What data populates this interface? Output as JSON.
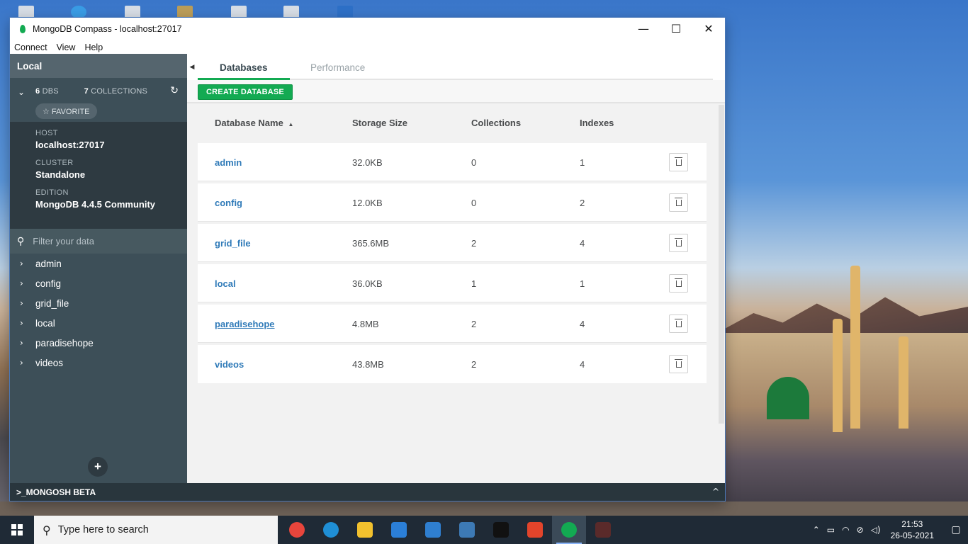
{
  "window": {
    "title": "MongoDB Compass - localhost:27017",
    "controls": {
      "minimize": "—",
      "maximize": "☐",
      "close": "✕"
    }
  },
  "menu": [
    "Connect",
    "View",
    "Help"
  ],
  "sidebar": {
    "header": "Local",
    "dbs_count": "6",
    "dbs_label": "DBS",
    "collections_count": "7",
    "collections_label": "COLLECTIONS",
    "favorite_label": "☆ FAVORITE",
    "host_label": "HOST",
    "host_value": "localhost:27017",
    "cluster_label": "CLUSTER",
    "cluster_value": "Standalone",
    "edition_label": "EDITION",
    "edition_value": "MongoDB 4.4.5 Community",
    "filter_placeholder": "Filter your data",
    "databases": [
      "admin",
      "config",
      "grid_file",
      "local",
      "paradisehope",
      "videos"
    ],
    "add_label": "+"
  },
  "tabs": {
    "active": "Databases",
    "inactive": "Performance"
  },
  "toolbar": {
    "create_label": "CREATE DATABASE"
  },
  "table": {
    "headers": {
      "name": "Database Name",
      "size": "Storage Size",
      "collections": "Collections",
      "indexes": "Indexes"
    },
    "sort_indicator": "▲",
    "rows": [
      {
        "name": "admin",
        "size": "32.0KB",
        "collections": "0",
        "indexes": "1"
      },
      {
        "name": "config",
        "size": "12.0KB",
        "collections": "0",
        "indexes": "2"
      },
      {
        "name": "grid_file",
        "size": "365.6MB",
        "collections": "2",
        "indexes": "4"
      },
      {
        "name": "local",
        "size": "36.0KB",
        "collections": "1",
        "indexes": "1"
      },
      {
        "name": "paradisehope",
        "size": "4.8MB",
        "collections": "2",
        "indexes": "4"
      },
      {
        "name": "videos",
        "size": "43.8MB",
        "collections": "2",
        "indexes": "4"
      }
    ]
  },
  "shell": {
    "label": ">_MONGOSH BETA",
    "toggle": "^"
  },
  "taskbar": {
    "search_placeholder": "Type here to search",
    "time": "21:53",
    "date": "26-05-2021",
    "apps": [
      {
        "name": "chrome",
        "color": "#e8453c"
      },
      {
        "name": "edge",
        "color": "#1f8fd6"
      },
      {
        "name": "file-explorer",
        "color": "#f2c12e"
      },
      {
        "name": "mail",
        "color": "#2b7fd8"
      },
      {
        "name": "store",
        "color": "#2f7fd0"
      },
      {
        "name": "python",
        "color": "#3d7ab5"
      },
      {
        "name": "terminal",
        "color": "#111111"
      },
      {
        "name": "p-app",
        "color": "#e2442b"
      },
      {
        "name": "mongodb-compass",
        "color": "#13aa52"
      },
      {
        "name": "game-app",
        "color": "#5a2a2a"
      }
    ]
  },
  "colors": {
    "accent": "#13aa52",
    "sidebar": "#3d4f58",
    "link": "#2f7ab8"
  }
}
